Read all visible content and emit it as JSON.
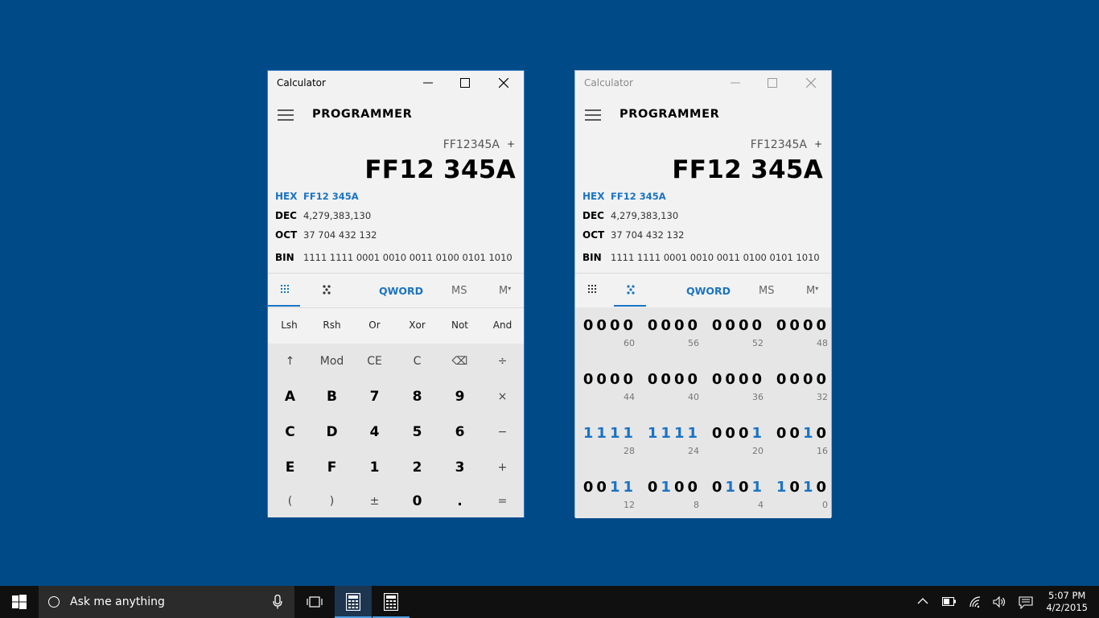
{
  "windows": [
    {
      "title": "Calculator",
      "mode": "PROGRAMMER",
      "expression": "FF12345A",
      "expression_op": "+",
      "result": "FF12 345A",
      "radix": [
        {
          "label": "HEX",
          "value": "FF12 345A",
          "active": true
        },
        {
          "label": "DEC",
          "value": "4,279,383,130",
          "active": false
        },
        {
          "label": "OCT",
          "value": "37 704 432 132",
          "active": false
        },
        {
          "label": "BIN",
          "value": "1111 1111 0001 0010 0011 0100 0101 1010",
          "active": false
        }
      ],
      "word_size": "QWORD",
      "memory_store": "MS",
      "memory_dropdown": "M",
      "bit_ops": [
        "Lsh",
        "Rsh",
        "Or",
        "Xor",
        "Not",
        "And"
      ],
      "keys": [
        [
          "↑",
          "Mod",
          "CE",
          "C",
          "⌫",
          "÷"
        ],
        [
          "A",
          "B",
          "7",
          "8",
          "9",
          "×"
        ],
        [
          "C",
          "D",
          "4",
          "5",
          "6",
          "−"
        ],
        [
          "E",
          "F",
          "1",
          "2",
          "3",
          "+"
        ],
        [
          "(",
          ")",
          "±",
          "0",
          ".",
          "="
        ]
      ]
    },
    {
      "title": "Calculator",
      "mode": "PROGRAMMER",
      "expression": "FF12345A",
      "expression_op": "+",
      "result": "FF12 345A",
      "radix": [
        {
          "label": "HEX",
          "value": "FF12 345A",
          "active": true
        },
        {
          "label": "DEC",
          "value": "4,279,383,130",
          "active": false
        },
        {
          "label": "OCT",
          "value": "37 704 432 132",
          "active": false
        },
        {
          "label": "BIN",
          "value": "1111 1111 0001 0010 0011 0100 0101 1010",
          "active": false
        }
      ],
      "word_size": "QWORD",
      "memory_store": "MS",
      "memory_dropdown": "M",
      "bit_groups": [
        {
          "bits": "0000",
          "pos": "60"
        },
        {
          "bits": "0000",
          "pos": "56"
        },
        {
          "bits": "0000",
          "pos": "52"
        },
        {
          "bits": "0000",
          "pos": "48"
        },
        {
          "bits": "0000",
          "pos": "44"
        },
        {
          "bits": "0000",
          "pos": "40"
        },
        {
          "bits": "0000",
          "pos": "36"
        },
        {
          "bits": "0000",
          "pos": "32"
        },
        {
          "bits": "1111",
          "pos": "28"
        },
        {
          "bits": "1111",
          "pos": "24"
        },
        {
          "bits": "0001",
          "pos": "20"
        },
        {
          "bits": "0010",
          "pos": "16"
        },
        {
          "bits": "0011",
          "pos": "12"
        },
        {
          "bits": "0100",
          "pos": "8"
        },
        {
          "bits": "0101",
          "pos": "4"
        },
        {
          "bits": "1010",
          "pos": "0"
        }
      ]
    }
  ],
  "taskbar": {
    "search_placeholder": "Ask me anything",
    "time": "5:07 PM",
    "date": "4/2/2015"
  },
  "colors": {
    "desktop": "#004a88",
    "accent": "#1a73c4",
    "taskbar": "#101010"
  }
}
